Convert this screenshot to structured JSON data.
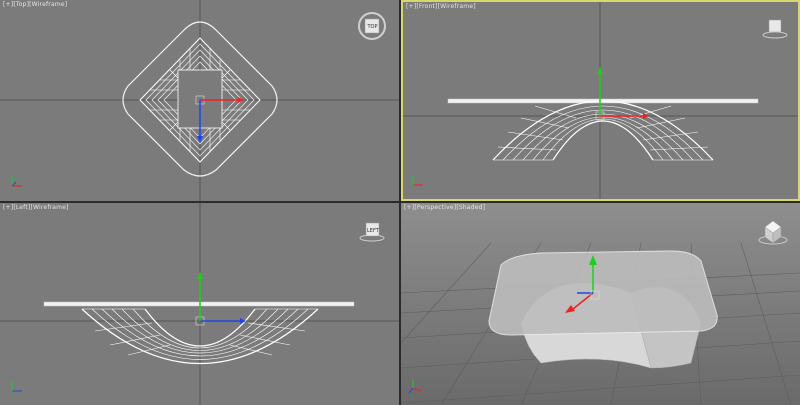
{
  "viewports": {
    "top": {
      "plus": "[+]",
      "view": "[Top]",
      "mode": "[Wireframe]",
      "cube_label": "TOP"
    },
    "front": {
      "plus": "[+]",
      "view": "[Front]",
      "mode": "[Wireframe]"
    },
    "left": {
      "plus": "[+]",
      "view": "[Left]",
      "mode": "[Wireframe]",
      "cube_label": "LEFT"
    },
    "perspective": {
      "plus": "[+]",
      "view": "[Perspective]",
      "mode": "[Shaded]"
    }
  },
  "colors": {
    "active_border": "#d8d86a",
    "viewport_bg": "#7b7b7b",
    "grid_line": "#6a6a6a",
    "axis_x": "#e22",
    "axis_y": "#2c2",
    "axis_z": "#24e"
  },
  "icons": [
    "view-cube-icon",
    "gizmo-icon",
    "axis-tripod-icon"
  ]
}
